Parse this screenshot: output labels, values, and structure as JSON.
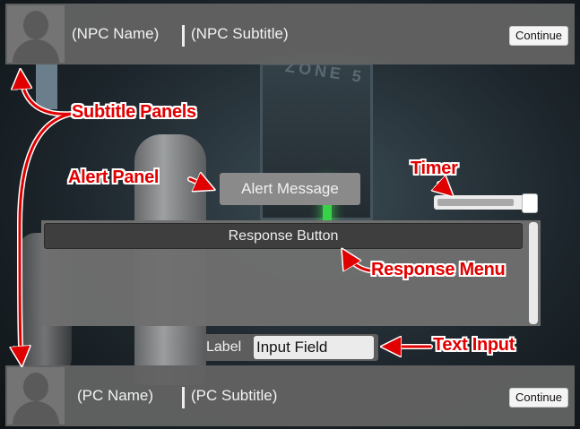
{
  "subtitle_top": {
    "name": "(NPC Name)",
    "subtitle": "(NPC Subtitle)",
    "continue_label": "Continue"
  },
  "subtitle_bottom": {
    "name": "(PC Name)",
    "subtitle": "(PC Subtitle)",
    "continue_label": "Continue"
  },
  "alert": {
    "message": "Alert Message"
  },
  "timer": {
    "fraction": 0.92
  },
  "response_menu": {
    "button_label": "Response Button"
  },
  "text_input": {
    "label": "Label",
    "value": "Input Field"
  },
  "annotations": {
    "subtitle_panels": "Subtitle Panels",
    "alert_panel": "Alert Panel",
    "timer": "Timer",
    "response_menu": "Response Menu",
    "text_input": "Text Input"
  },
  "colors": {
    "annotation": "#e00000",
    "panel": "#626262",
    "button_dark": "#3e3e3e"
  }
}
